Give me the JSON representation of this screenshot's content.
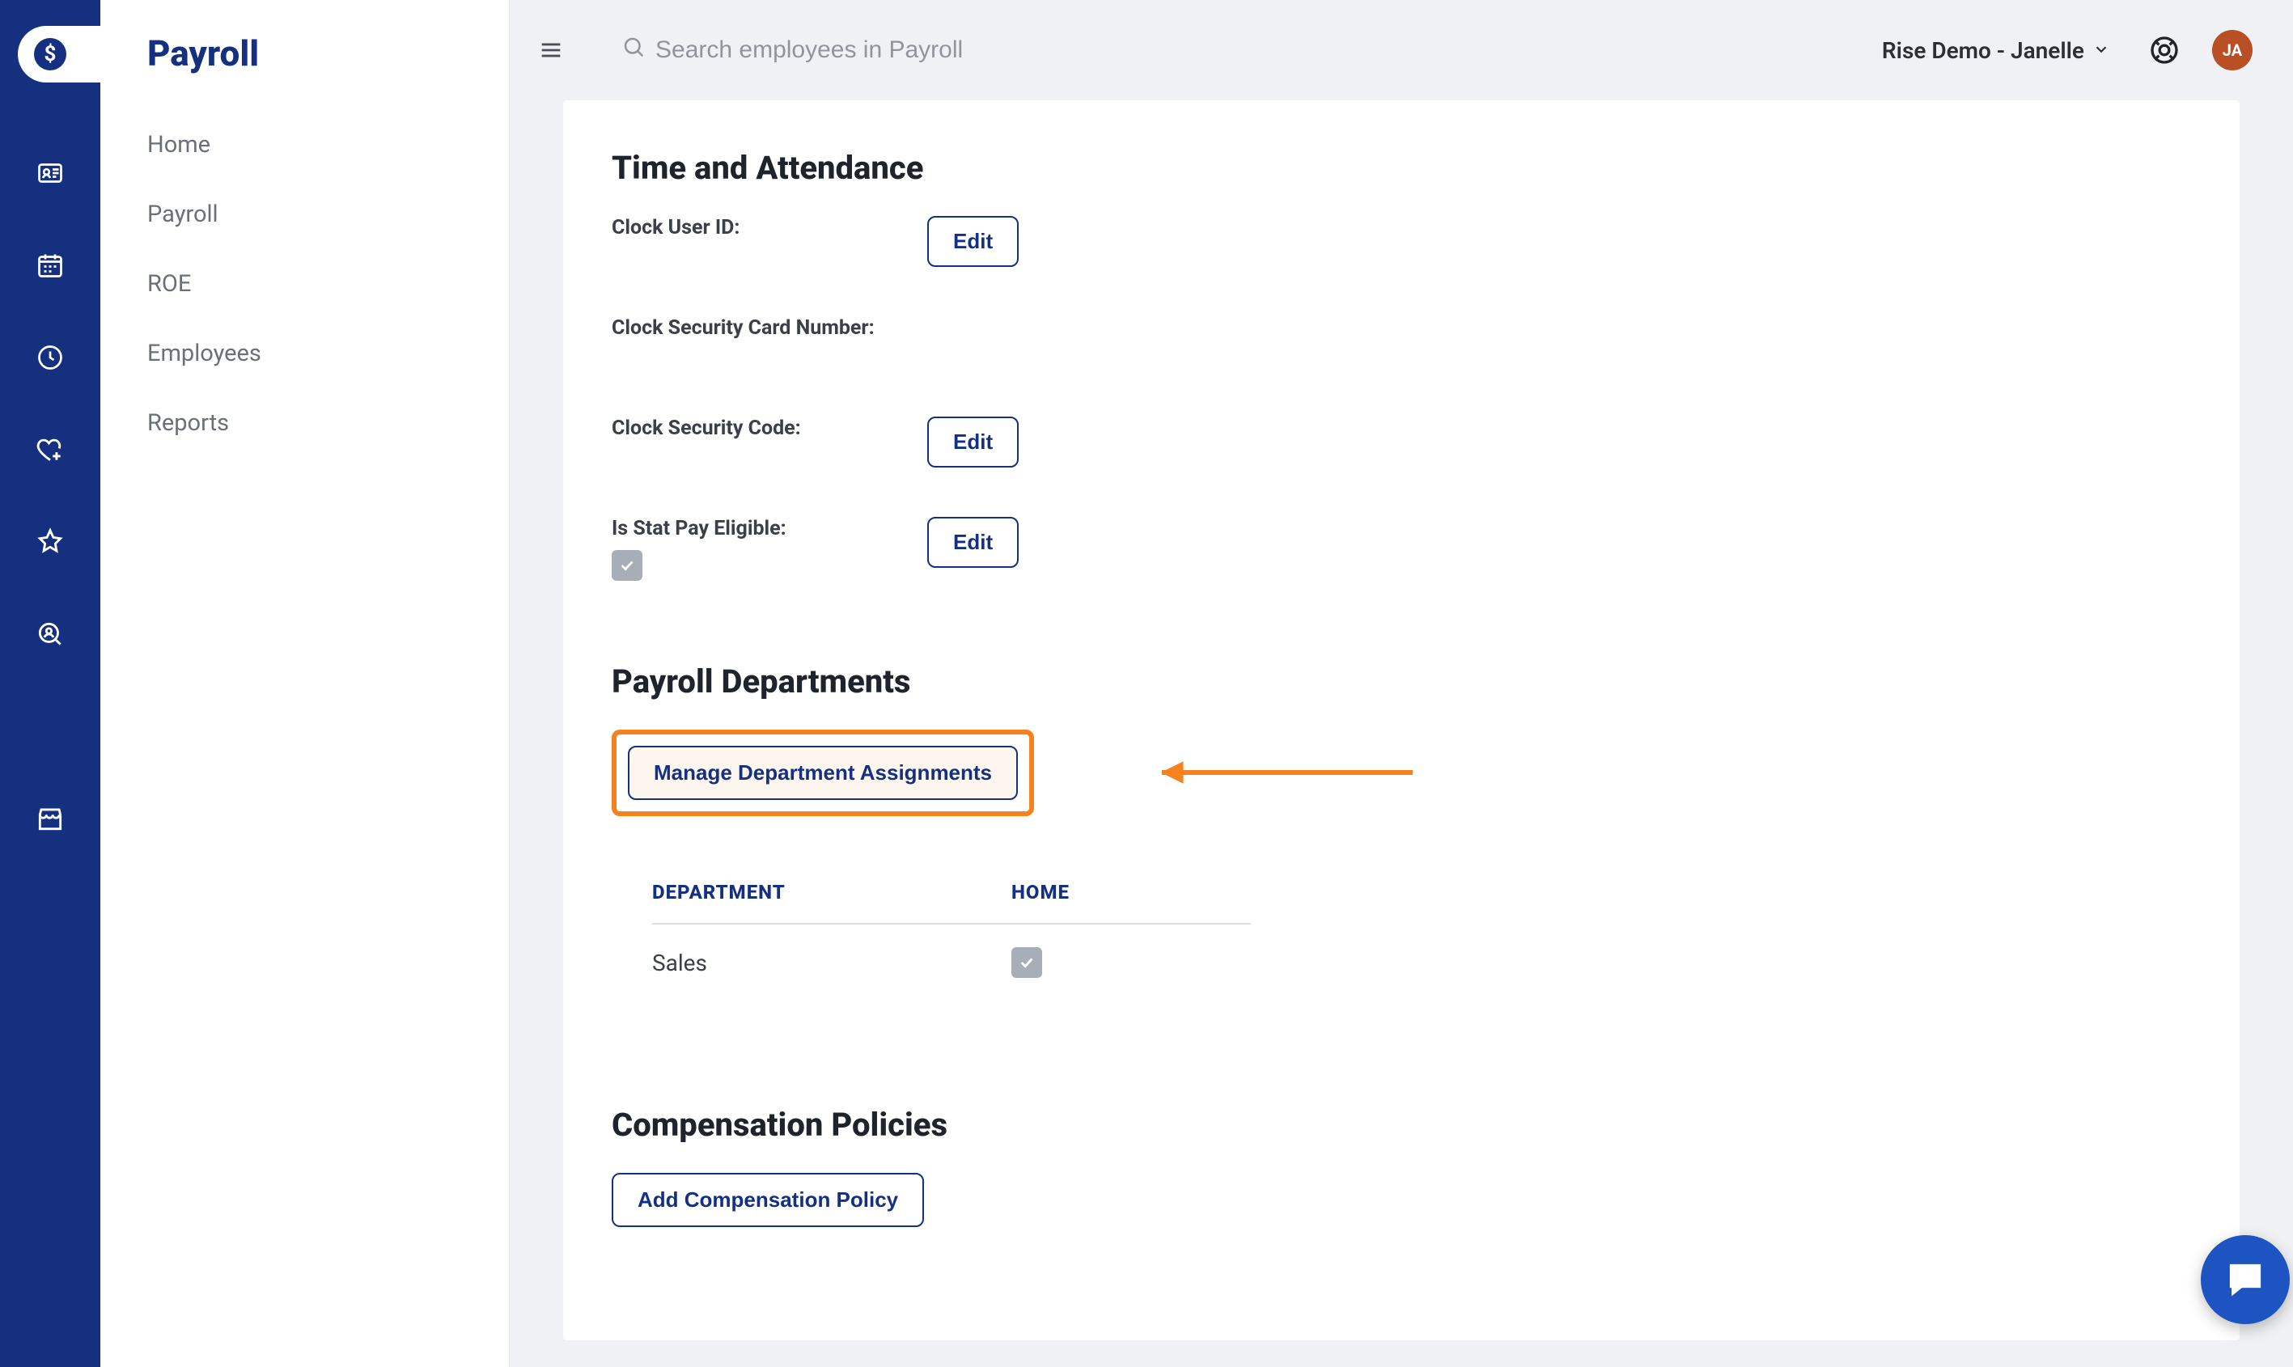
{
  "sidebar": {
    "title": "Payroll",
    "items": [
      {
        "label": "Home"
      },
      {
        "label": "Payroll"
      },
      {
        "label": "ROE"
      },
      {
        "label": "Employees"
      },
      {
        "label": "Reports"
      }
    ]
  },
  "rail": {
    "items": [
      {
        "name": "logo"
      },
      {
        "name": "people"
      },
      {
        "name": "calendar"
      },
      {
        "name": "clock"
      },
      {
        "name": "heart"
      },
      {
        "name": "star"
      },
      {
        "name": "profile-search"
      },
      {
        "name": "payroll",
        "active": true
      },
      {
        "name": "store"
      }
    ]
  },
  "topbar": {
    "search_placeholder": "Search employees in Payroll",
    "org_label": "Rise Demo - Janelle",
    "avatar_initials": "JA"
  },
  "sections": {
    "time_attendance": {
      "title": "Time and Attendance",
      "fields": {
        "clock_user_id_label": "Clock User ID:",
        "clock_security_card_label": "Clock Security Card Number:",
        "clock_security_code_label": "Clock Security Code:",
        "stat_pay_label": "Is Stat Pay Eligible:",
        "stat_pay_checked": true
      },
      "edit_label": "Edit"
    },
    "payroll_departments": {
      "title": "Payroll Departments",
      "manage_button": "Manage Department Assignments",
      "columns": {
        "department": "DEPARTMENT",
        "home": "HOME"
      },
      "rows": [
        {
          "department": "Sales",
          "home": true
        }
      ]
    },
    "compensation": {
      "title": "Compensation Policies",
      "add_button": "Add Compensation Policy"
    }
  },
  "colors": {
    "brand_navy": "#14307f",
    "accent_orange": "#f5821f",
    "avatar_bg": "#b94f24",
    "chat_bg": "#1d54c2"
  }
}
